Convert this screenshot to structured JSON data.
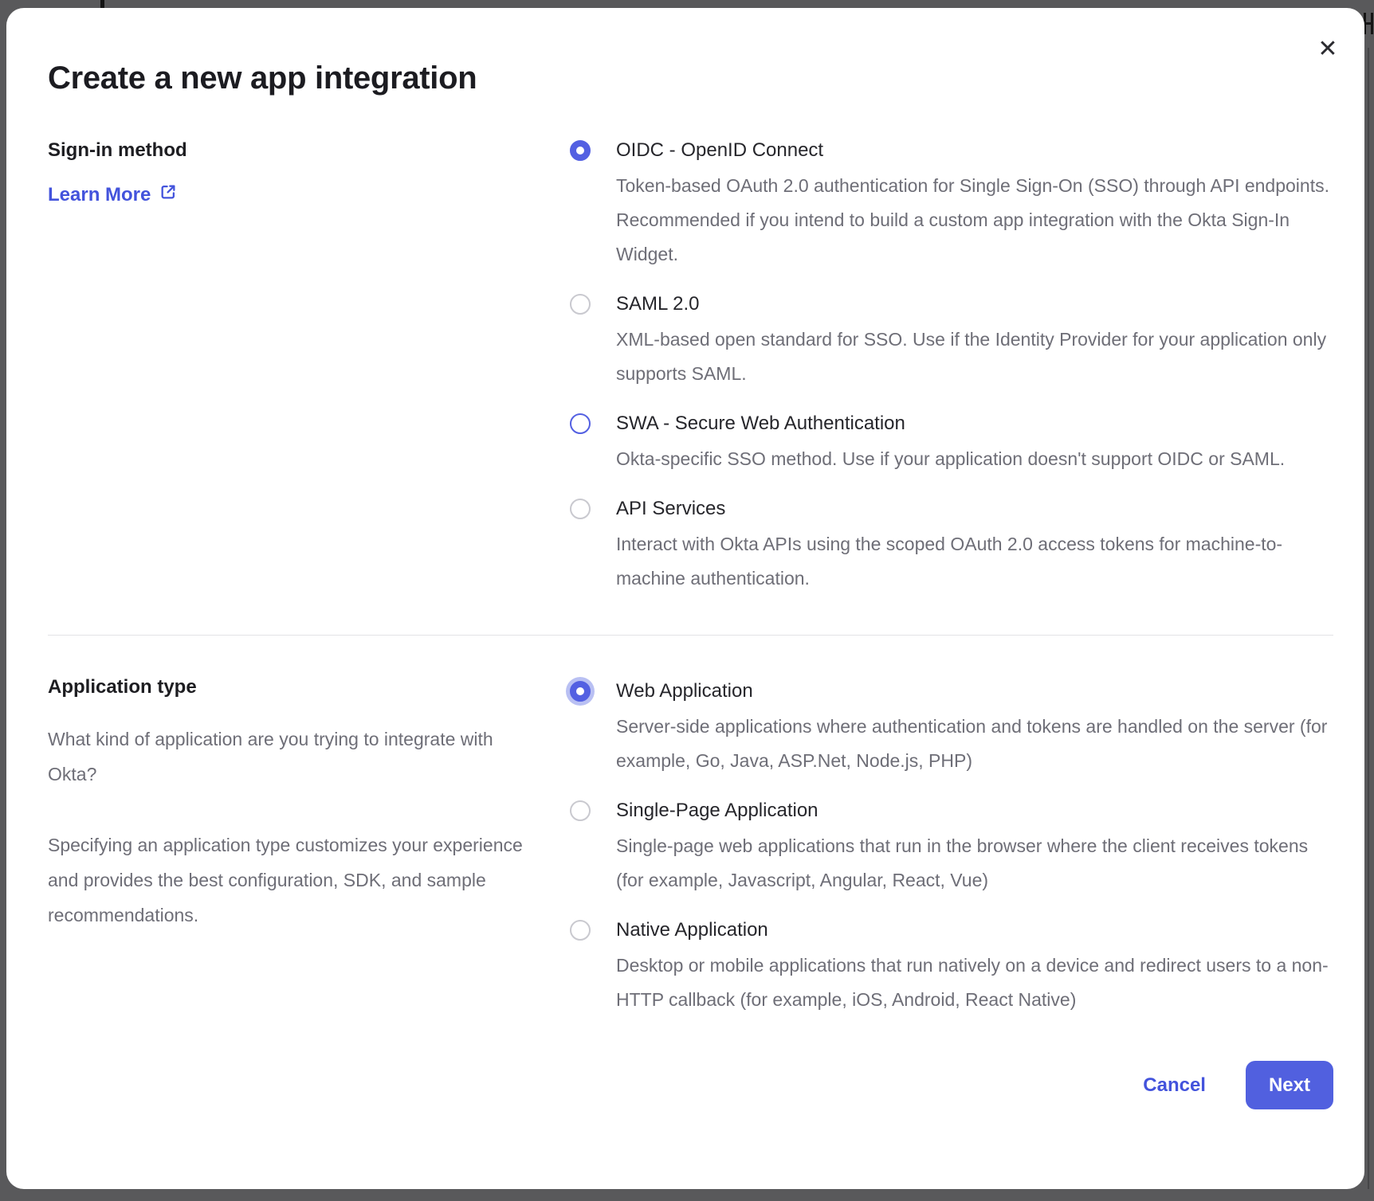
{
  "modal": {
    "title": "Create a new app integration",
    "close_icon": "✕"
  },
  "sign_in": {
    "heading": "Sign-in method",
    "learn_more": {
      "label": "Learn More",
      "icon": "external-link-icon"
    },
    "options": [
      {
        "label": "OIDC - OpenID Connect",
        "description": "Token-based OAuth 2.0 authentication for Single Sign-On (SSO) through API endpoints. Recommended if you intend to build a custom app integration with the Okta Sign-In Widget.",
        "selected": true,
        "state": "selected"
      },
      {
        "label": "SAML 2.0",
        "description": "XML-based open standard for SSO. Use if the Identity Provider for your application only supports SAML.",
        "selected": false,
        "state": "default"
      },
      {
        "label": "SWA - Secure Web Authentication",
        "description": "Okta-specific SSO method. Use if your application doesn't support OIDC or SAML.",
        "selected": false,
        "state": "accent-border"
      },
      {
        "label": "API Services",
        "description": "Interact with Okta APIs using the scoped OAuth 2.0 access tokens for machine-to-machine authentication.",
        "selected": false,
        "state": "default"
      }
    ]
  },
  "application_type": {
    "heading": "Application type",
    "intro_paragraphs": [
      "What kind of application are you trying to integrate with Okta?",
      "Specifying an application type customizes your experience and provides the best configuration, SDK, and sample recommendations."
    ],
    "options": [
      {
        "label": "Web Application",
        "description": "Server-side applications where authentication and tokens are handled on the server (for example, Go, Java, ASP.Net, Node.js, PHP)",
        "selected": true,
        "state": "selected-focused"
      },
      {
        "label": "Single-Page Application",
        "description": "Single-page web applications that run in the browser where the client receives tokens (for example, Javascript, Angular, React, Vue)",
        "selected": false,
        "state": "default"
      },
      {
        "label": "Native Application",
        "description": "Desktop or mobile applications that run natively on a device and redirect users to a non-HTTP callback (for example, iOS, Android, React Native)",
        "selected": false,
        "state": "default"
      }
    ]
  },
  "footer": {
    "cancel_label": "Cancel",
    "next_label": "Next"
  },
  "colors": {
    "accent": "#5360e2",
    "link": "#4353dc",
    "next_button_bg": "#5160df",
    "backdrop_overlay": "#59595b",
    "body_text": "#6e6e77",
    "heading_text": "#1d1d21"
  }
}
